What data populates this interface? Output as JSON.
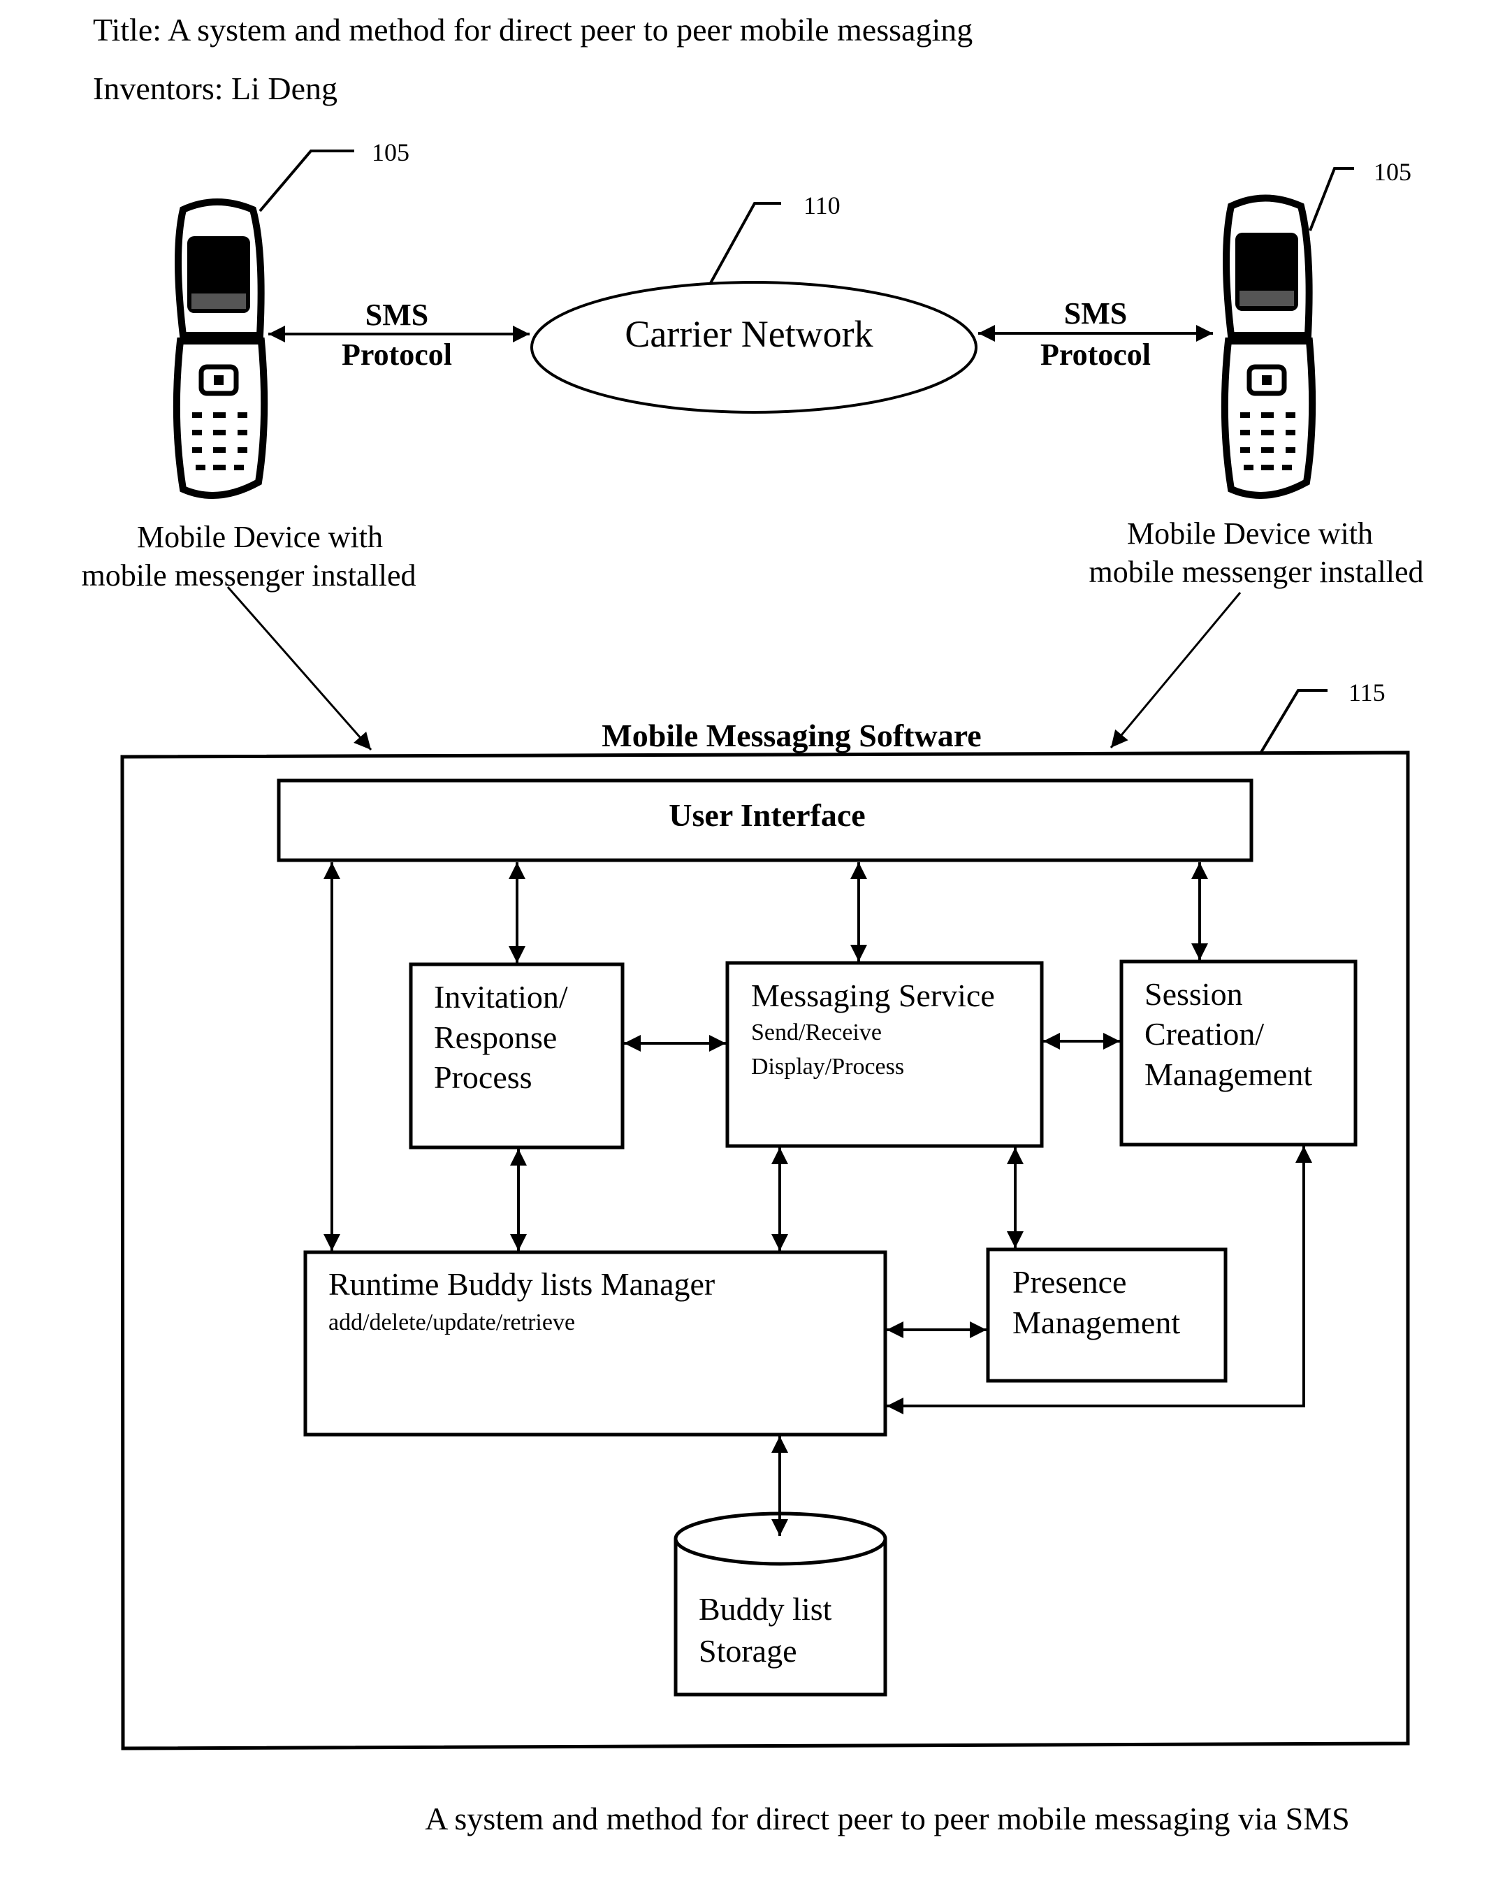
{
  "header": {
    "title": "Title:  A system and method for direct peer to peer mobile messaging",
    "inventors": "Inventors:  Li Deng"
  },
  "devices": {
    "left": {
      "ref": "105",
      "icon": "flip-phone-icon",
      "label_line1": "Mobile Device with",
      "label_line2": "mobile messenger installed"
    },
    "right": {
      "ref": "105",
      "icon": "flip-phone-icon",
      "label_line1": "Mobile Device with",
      "label_line2": "mobile messenger installed"
    }
  },
  "links": {
    "left": {
      "line1": "SMS",
      "line2": "Protocol"
    },
    "right": {
      "line1": "SMS",
      "line2": "Protocol"
    }
  },
  "network": {
    "ref": "110",
    "label": "Carrier Network"
  },
  "software": {
    "ref": "115",
    "title": "Mobile Messaging Software",
    "user_interface": "User Interface",
    "invitation": {
      "lines": [
        "Invitation/",
        "Response",
        "Process"
      ]
    },
    "messaging": {
      "title": "Messaging Service",
      "sub": [
        "Send/Receive",
        "Display/Process"
      ]
    },
    "session": {
      "lines": [
        "Session",
        "Creation/",
        "Management"
      ]
    },
    "buddy_manager": {
      "title": "Runtime Buddy lists Manager",
      "sub": "add/delete/update/retrieve"
    },
    "presence": {
      "lines": [
        "Presence",
        "Management"
      ]
    },
    "storage": {
      "lines": [
        "Buddy list",
        "Storage"
      ]
    }
  },
  "caption": "A system and method for direct peer to peer mobile messaging via SMS"
}
